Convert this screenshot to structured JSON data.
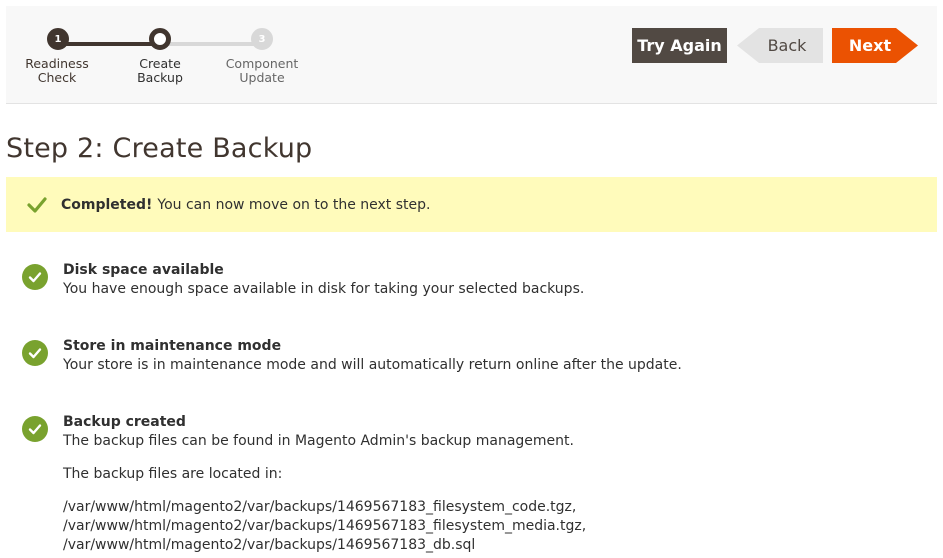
{
  "stepper": {
    "steps": [
      {
        "number": "1",
        "label": "Readiness\nCheck",
        "state": "done"
      },
      {
        "number": "",
        "label": "Create\nBackup",
        "state": "current"
      },
      {
        "number": "3",
        "label": "Component\nUpdate",
        "state": "todo"
      }
    ]
  },
  "toolbar": {
    "try_again_label": "Try Again",
    "back_label": "Back",
    "next_label": "Next"
  },
  "page": {
    "title": "Step 2: Create Backup"
  },
  "message": {
    "bold": "Completed!",
    "text": "You can now move on to the next step."
  },
  "checks": [
    {
      "heading": "Disk space available",
      "description": "You have enough space available in disk for taking your selected backups."
    },
    {
      "heading": "Store in maintenance mode",
      "description": "Your store is in maintenance mode and will automatically return online after the update."
    },
    {
      "heading": "Backup created",
      "description": "The backup files can be found in Magento Admin's backup management.",
      "location_label": "The backup files are located in:",
      "files": [
        "/var/www/html/magento2/var/backups/1469567183_filesystem_code.tgz,",
        "/var/www/html/magento2/var/backups/1469567183_filesystem_media.tgz,",
        "/var/www/html/magento2/var/backups/1469567183_db.sql"
      ]
    }
  ],
  "colors": {
    "accent": "#eb5202",
    "dark": "#514943",
    "success": "#79a22e",
    "notice_bg": "#fffbbb"
  }
}
